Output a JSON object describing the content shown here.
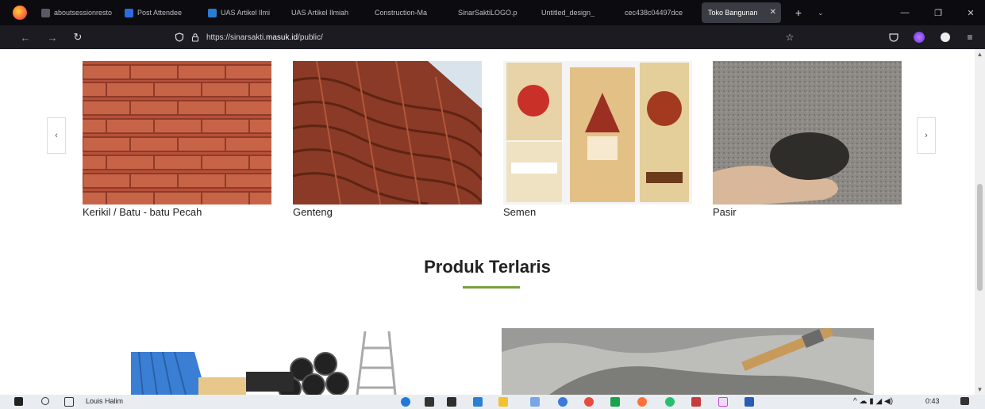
{
  "browser": {
    "tabs": [
      {
        "label": "aboutsessionresto",
        "color": "#5a5a66"
      },
      {
        "label": "Post Attendee",
        "color": "#2d6cdf"
      },
      {
        "label": "UAS Artikel Ilmi",
        "color": "#2b7cd3"
      },
      {
        "label": "UAS Artikel Ilmiah",
        "color": "#5a5a66"
      },
      {
        "label": "Construction-Ma",
        "color": "#5a5a66"
      },
      {
        "label": "SinarSaktiLOGO.p",
        "color": "#5a5a66"
      },
      {
        "label": "Untitled_design_",
        "color": "#5a5a66"
      },
      {
        "label": "cec438c04497dce",
        "color": "#5a5a66"
      }
    ],
    "active_tab": {
      "label": "Toko Bangunan",
      "close": "✕"
    },
    "new_tab": "+",
    "tab_list": "⌄",
    "url_prefix": "https://sinarsakti.",
    "url_host": "masuk.id",
    "url_suffix": "/public/"
  },
  "carousel": {
    "prev": "‹",
    "next": "›",
    "items": [
      {
        "caption": "Kerikil / Batu - batu Pecah"
      },
      {
        "caption": "Genteng"
      },
      {
        "caption": "Semen"
      },
      {
        "caption": "Pasir"
      }
    ]
  },
  "section": {
    "title": "Produk Terlaris",
    "accent": "#78a040"
  },
  "taskbar": {
    "user": "Louis Halim",
    "time": "0:43"
  },
  "icons": {
    "back": "arrow-left-icon",
    "forward": "arrow-right-icon",
    "reload": "reload-icon",
    "shield": "tracking-shield-icon",
    "lock": "lock-icon",
    "bookmark": "star-icon",
    "pocket": "pocket-icon",
    "account": "account-icon",
    "menu": "hamburger-menu-icon"
  }
}
